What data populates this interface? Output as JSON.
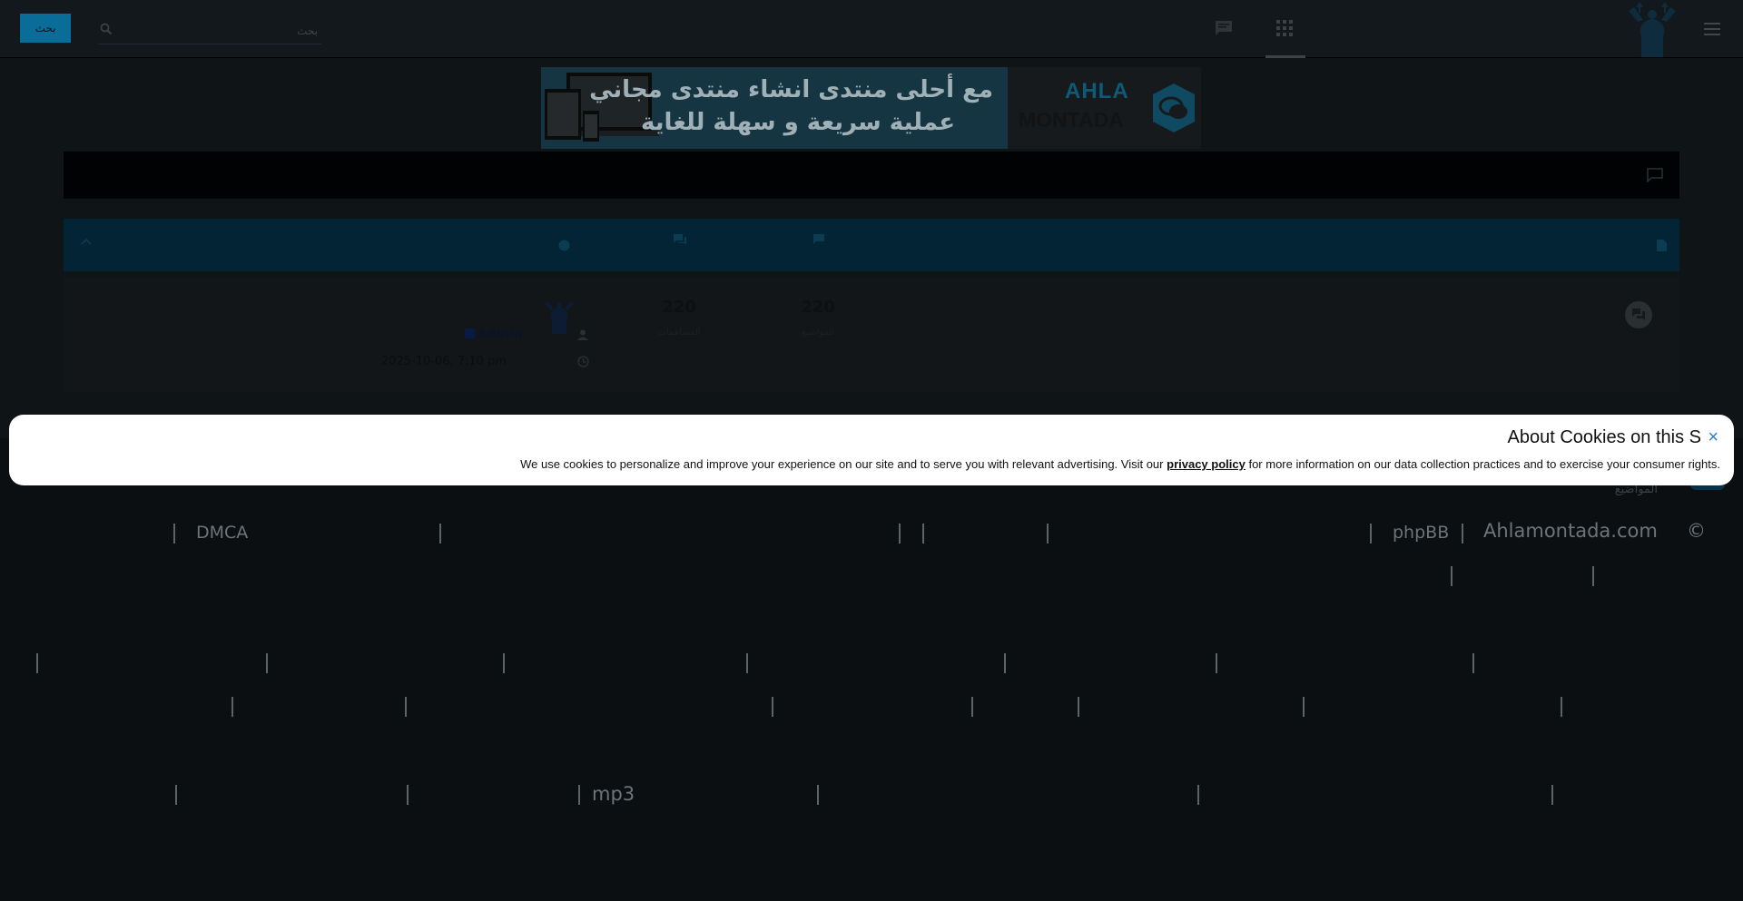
{
  "topbar": {
    "main_button_label": "بحث",
    "search_placeholder": "بحث",
    "nav_icons": [
      "chat-icon",
      "apps-grid-icon"
    ],
    "menu_icon": "menu-icon"
  },
  "banner": {
    "headline_line1": "مع أحلى منتدى انشاء منتدى مجاني",
    "headline_line2": "عملية سريعة و سهلة للغاية",
    "brand_line1": "AHLA",
    "brand_line2": "MONTADA"
  },
  "stats": {
    "topics_value": "220",
    "topics_label": "المواضيع",
    "posts_value": "220",
    "posts_label": "المساهمات",
    "last_post_user": "Admin",
    "last_post_date": "2025-10-06, 7:10 pm"
  },
  "footer": {
    "extra_label": "المواضيع",
    "row1": {
      "copyright_symbol": "©",
      "site": "Ahlamontada.com",
      "engine": "phpBB",
      "dmca": "DMCA"
    },
    "row4": {
      "mp3": "mp3"
    }
  },
  "cookie": {
    "title": "About Cookies on this S",
    "close_label": "×",
    "text_before": "We use cookies to personalize and improve your experience on our site and to serve you with relevant advertising. Visit our",
    "link_label": "privacy policy",
    "text_after": "for more information on our data collection practices and to exercise your consumer rights."
  },
  "colors": {
    "accent": "#0a6d99",
    "cookie_close": "#2b80d4"
  }
}
